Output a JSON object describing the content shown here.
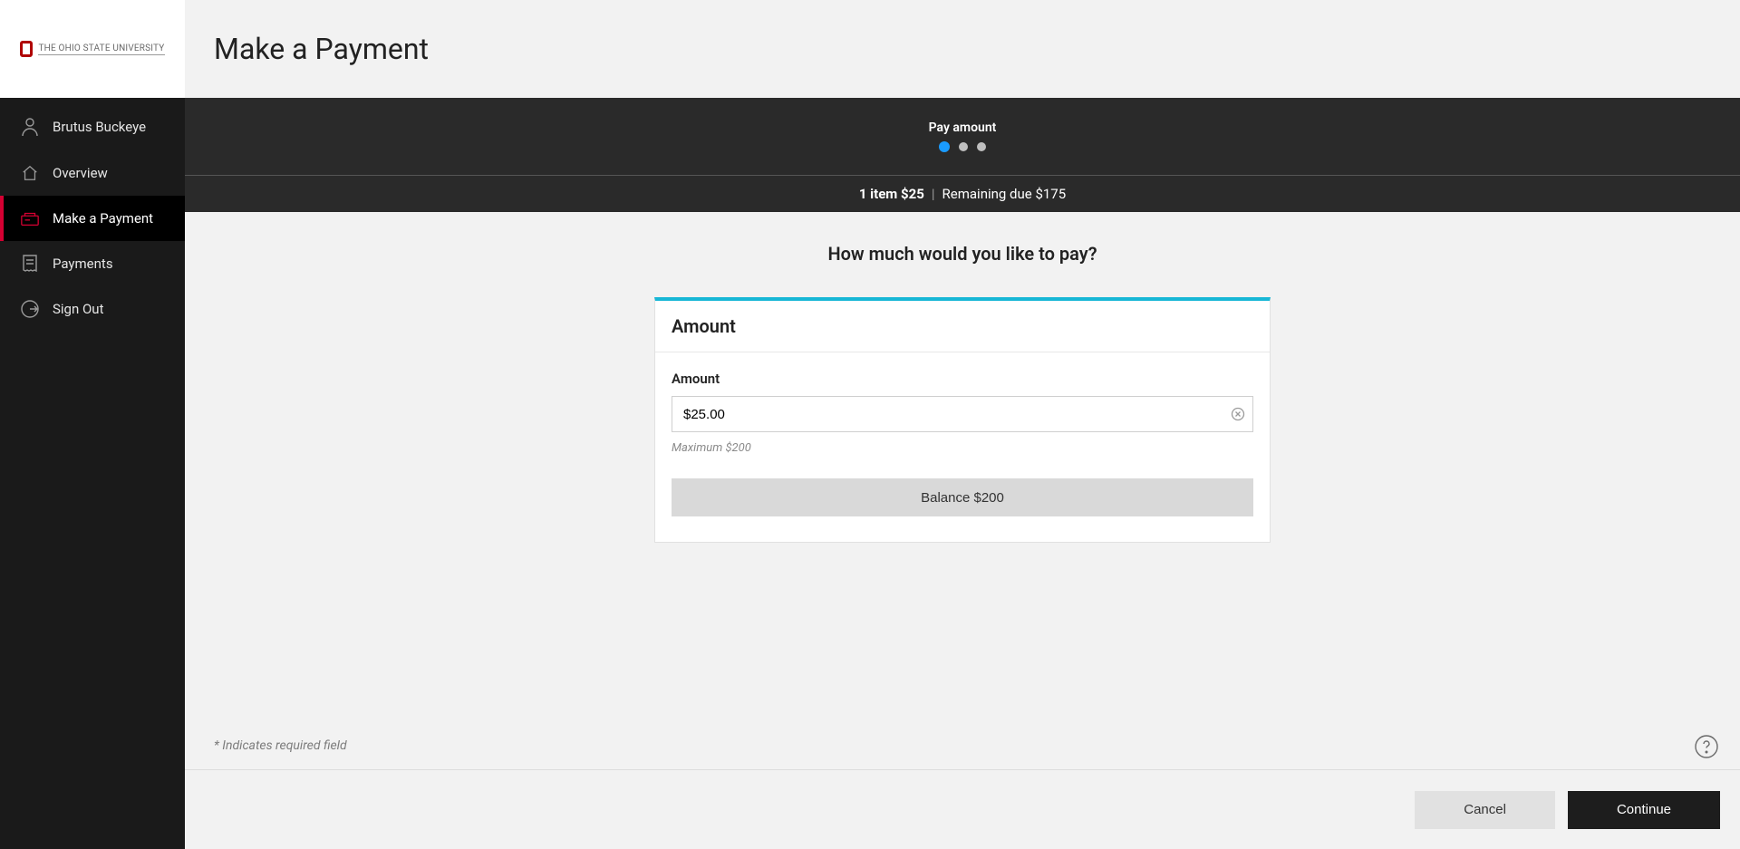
{
  "logo": {
    "text": "The Ohio State University"
  },
  "sidebar": {
    "items": [
      {
        "id": "user",
        "label": "Brutus Buckeye"
      },
      {
        "id": "overview",
        "label": "Overview"
      },
      {
        "id": "make-payment",
        "label": "Make a Payment"
      },
      {
        "id": "payments",
        "label": "Payments"
      },
      {
        "id": "sign-out",
        "label": "Sign Out"
      }
    ]
  },
  "header": {
    "title": "Make a Payment"
  },
  "progress": {
    "step_label": "Pay amount",
    "summary_items": "1 item $25",
    "summary_remaining": "Remaining due $175"
  },
  "form": {
    "question": "How much would you like to pay?",
    "card_title": "Amount",
    "field_label": "Amount",
    "amount_value": "$25.00",
    "maximum_hint": "Maximum $200",
    "balance_button": "Balance $200"
  },
  "footer": {
    "required_note": "* Indicates required field",
    "cancel": "Cancel",
    "continue": "Continue"
  },
  "colors": {
    "accent_red": "#d50032",
    "accent_teal": "#17b7d6",
    "step_active": "#1a9bff"
  }
}
